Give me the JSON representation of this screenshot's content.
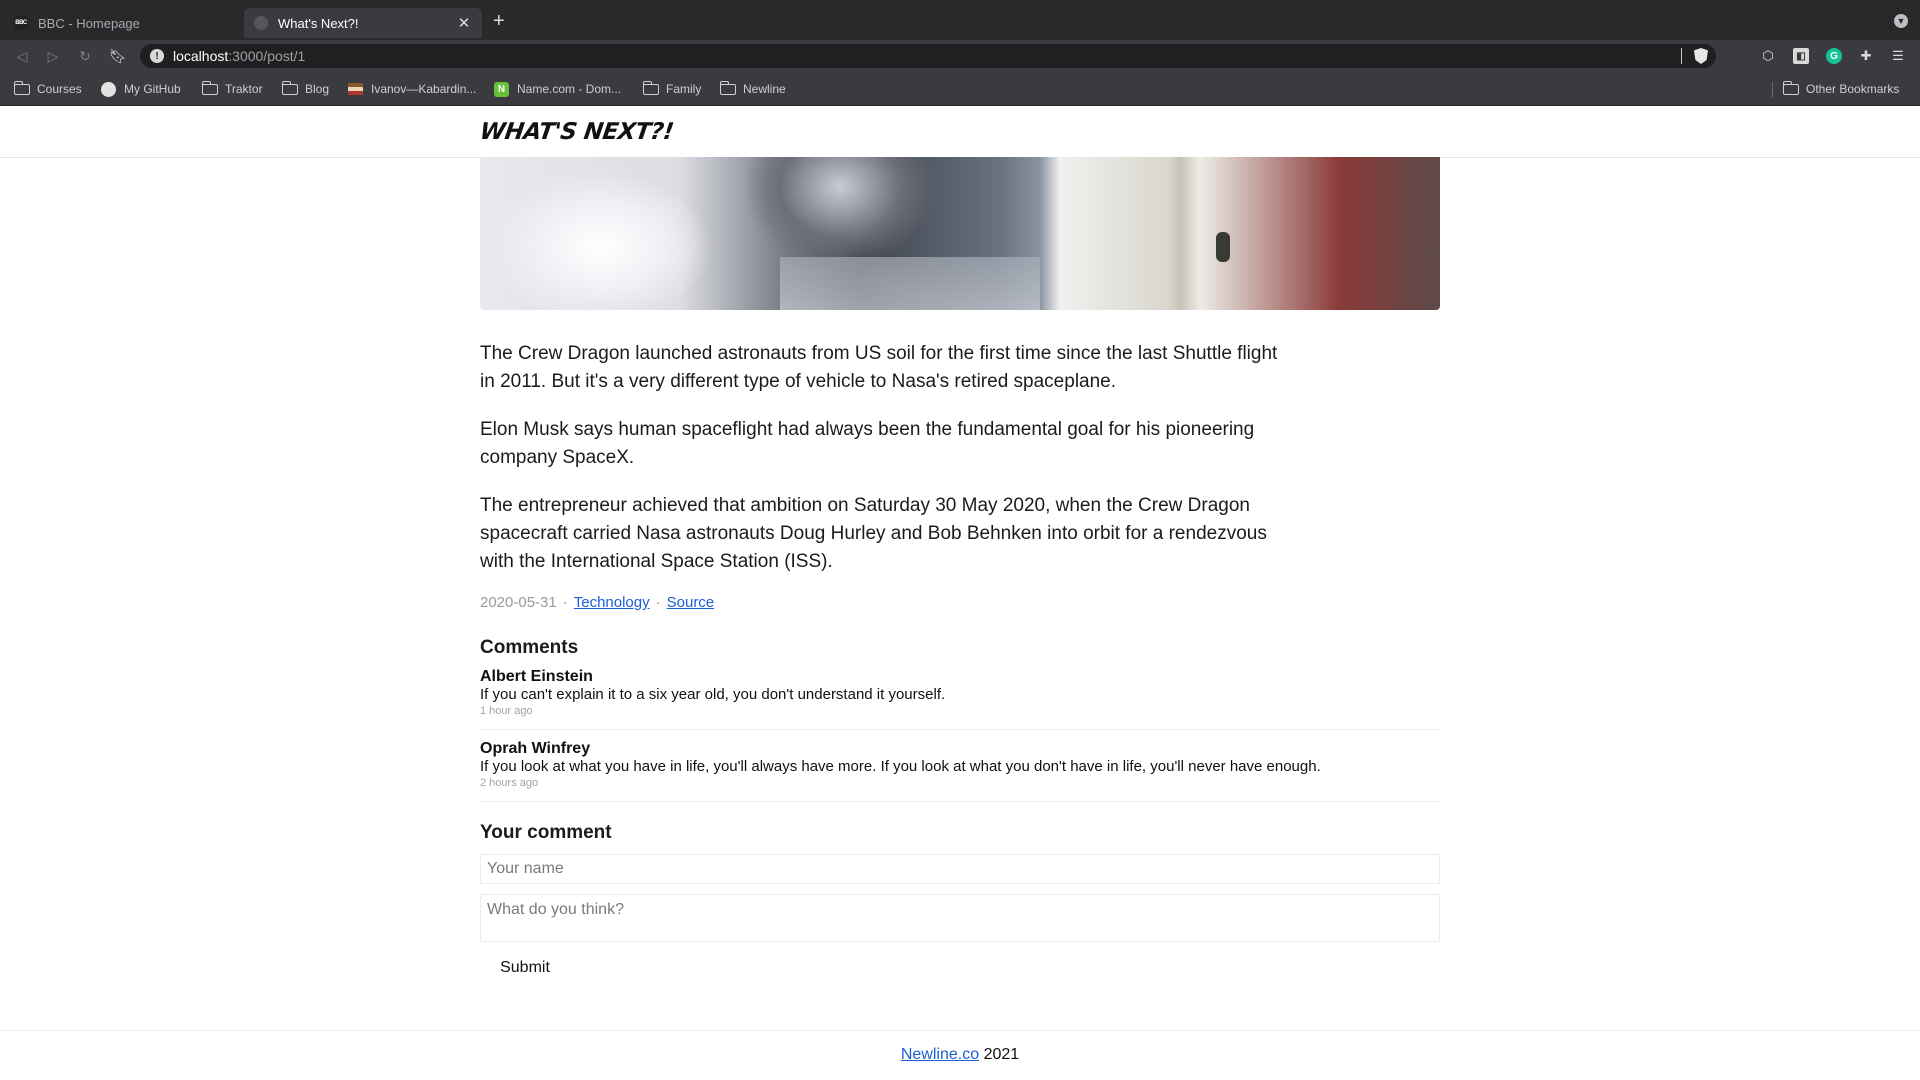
{
  "browser": {
    "tabs": [
      {
        "title": "BBC - Homepage",
        "favicon": "BBC",
        "active": false
      },
      {
        "title": "What's Next?!",
        "active": true
      }
    ],
    "address": {
      "host": "localhost",
      "path": ":3000/post/1"
    },
    "bookmarks": [
      {
        "label": "Courses",
        "icon": "folder-icon"
      },
      {
        "label": "My GitHub",
        "icon": "github-icon"
      },
      {
        "label": "Traktor",
        "icon": "folder-icon"
      },
      {
        "label": "Blog",
        "icon": "folder-icon"
      },
      {
        "label": "Ivanov—Kabardin...",
        "icon": "flag-icon"
      },
      {
        "label": "Name.com - Dom...",
        "icon": "namecom-icon"
      },
      {
        "label": "Family",
        "icon": "folder-icon"
      },
      {
        "label": "Newline",
        "icon": "folder-icon"
      }
    ],
    "other_bookmarks": "Other Bookmarks",
    "name_icon_letter": "N",
    "grammarly_letter": "G"
  },
  "site": {
    "logo": "What's Next?!"
  },
  "post": {
    "paragraphs": [
      "The Crew Dragon launched astronauts from US soil for the first time since the last Shuttle flight in 2011. But it's a very different type of vehicle to Nasa's retired spaceplane.",
      "Elon Musk says human spaceflight had always been the fundamental goal for his pioneering company SpaceX.",
      "The entrepreneur achieved that ambition on Saturday 30 May 2020, when the Crew Dragon spacecraft carried Nasa astronauts Doug Hurley and Bob Behnken into orbit for a rendezvous with the International Space Station (ISS)."
    ],
    "date": "2020-05-31",
    "separator": "·",
    "category": "Technology",
    "source": "Source"
  },
  "comments": {
    "title": "Comments",
    "items": [
      {
        "author": "Albert Einstein",
        "text": "If you can't explain it to a six year old, you don't understand it yourself.",
        "time": "1 hour ago"
      },
      {
        "author": "Oprah Winfrey",
        "text": "If you look at what you have in life, you'll always have more. If you look at what you don't have in life, you'll never have enough.",
        "time": "2 hours ago"
      }
    ]
  },
  "form": {
    "title": "Your comment",
    "name_placeholder": "Your name",
    "text_placeholder": "What do you think?",
    "submit": "Submit"
  },
  "footer": {
    "link": "Newline.co",
    "year": "2021"
  },
  "colors": {
    "link": "#1a5ed6",
    "chrome_dark": "#29292c",
    "chrome_mid": "#3b3b3f"
  }
}
